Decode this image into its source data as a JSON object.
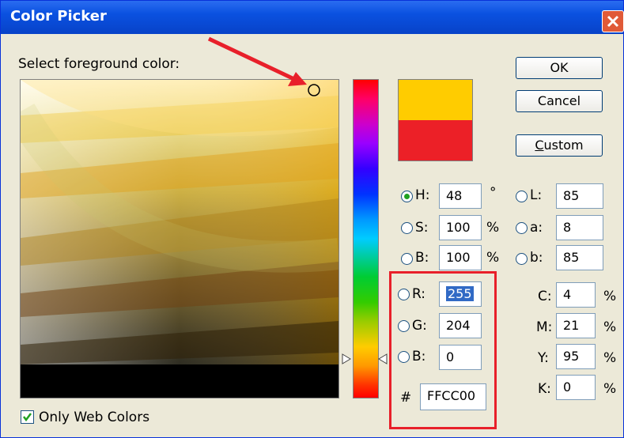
{
  "window": {
    "title": "Color Picker"
  },
  "picker": {
    "label": "Select foreground color:"
  },
  "buttons": {
    "ok": "OK",
    "cancel": "Cancel",
    "custom_prefix": "C",
    "custom_rest": "ustom"
  },
  "swatches": {
    "new_color": "#FFCC00",
    "current_color": "#EC2027"
  },
  "hsb": {
    "h": {
      "label": "H:",
      "value": "48",
      "unit": "°",
      "selected": true
    },
    "s": {
      "label": "S:",
      "value": "100",
      "unit": "%"
    },
    "b": {
      "label": "B:",
      "value": "100",
      "unit": "%"
    }
  },
  "lab": {
    "l": {
      "label": "L:",
      "value": "85"
    },
    "a": {
      "label": "a:",
      "value": "8"
    },
    "b": {
      "label": "b:",
      "value": "85"
    }
  },
  "rgb": {
    "r": {
      "label": "R:",
      "value": "255"
    },
    "g": {
      "label": "G:",
      "value": "204"
    },
    "b": {
      "label": "B:",
      "value": "0"
    }
  },
  "cmyk": {
    "c": {
      "label": "C:",
      "value": "4",
      "unit": "%"
    },
    "m": {
      "label": "M:",
      "value": "21",
      "unit": "%"
    },
    "y": {
      "label": "Y:",
      "value": "95",
      "unit": "%"
    },
    "k": {
      "label": "K:",
      "value": "0",
      "unit": "%"
    }
  },
  "hex": {
    "label": "#",
    "value": "FFCC00"
  },
  "web_colors": {
    "label": "Only Web Colors",
    "checked": true
  },
  "colors": {
    "highlight": "#E8202A",
    "title_bar": "#0A51E0"
  }
}
